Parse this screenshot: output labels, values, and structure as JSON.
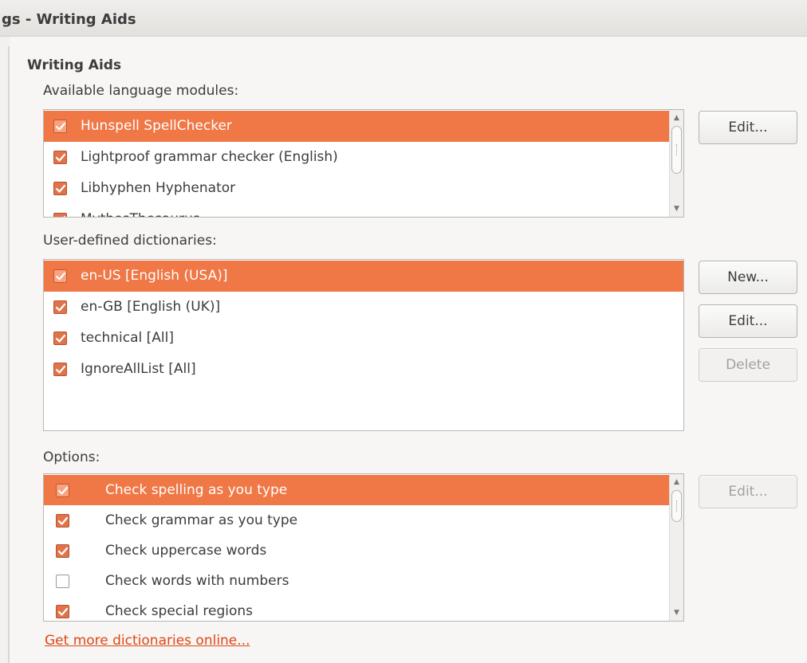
{
  "window": {
    "title": "gs - Writing Aids"
  },
  "section": {
    "title": "Writing Aids"
  },
  "language_modules": {
    "label": "Available language modules:",
    "items": [
      {
        "label": "Hunspell SpellChecker",
        "checked": true,
        "selected": true
      },
      {
        "label": "Lightproof grammar checker (English)",
        "checked": true,
        "selected": false
      },
      {
        "label": "Libhyphen Hyphenator",
        "checked": true,
        "selected": false
      },
      {
        "label": "MythesThesaurus",
        "checked": true,
        "selected": false
      }
    ],
    "edit_label": "Edit..."
  },
  "dictionaries": {
    "label": "User-defined dictionaries:",
    "items": [
      {
        "label": "en-US [English (USA)]",
        "checked": true,
        "selected": true
      },
      {
        "label": "en-GB [English (UK)]",
        "checked": true,
        "selected": false
      },
      {
        "label": "technical [All]",
        "checked": true,
        "selected": false
      },
      {
        "label": "IgnoreAllList [All]",
        "checked": true,
        "selected": false
      }
    ],
    "new_label": "New...",
    "edit_label": "Edit...",
    "delete_label": "Delete"
  },
  "options": {
    "label": "Options:",
    "items": [
      {
        "label": "Check spelling as you type",
        "checked": true,
        "selected": true
      },
      {
        "label": "Check grammar as you type",
        "checked": true,
        "selected": false
      },
      {
        "label": "Check uppercase words",
        "checked": true,
        "selected": false
      },
      {
        "label": "Check words with numbers",
        "checked": false,
        "selected": false
      },
      {
        "label": "Check special regions",
        "checked": true,
        "selected": false
      }
    ],
    "edit_label": "Edit..."
  },
  "link": {
    "label": "Get more dictionaries online..."
  },
  "colors": {
    "accent": "#f07746",
    "link": "#dd4814",
    "checkbox_fill": "#e1734a"
  }
}
